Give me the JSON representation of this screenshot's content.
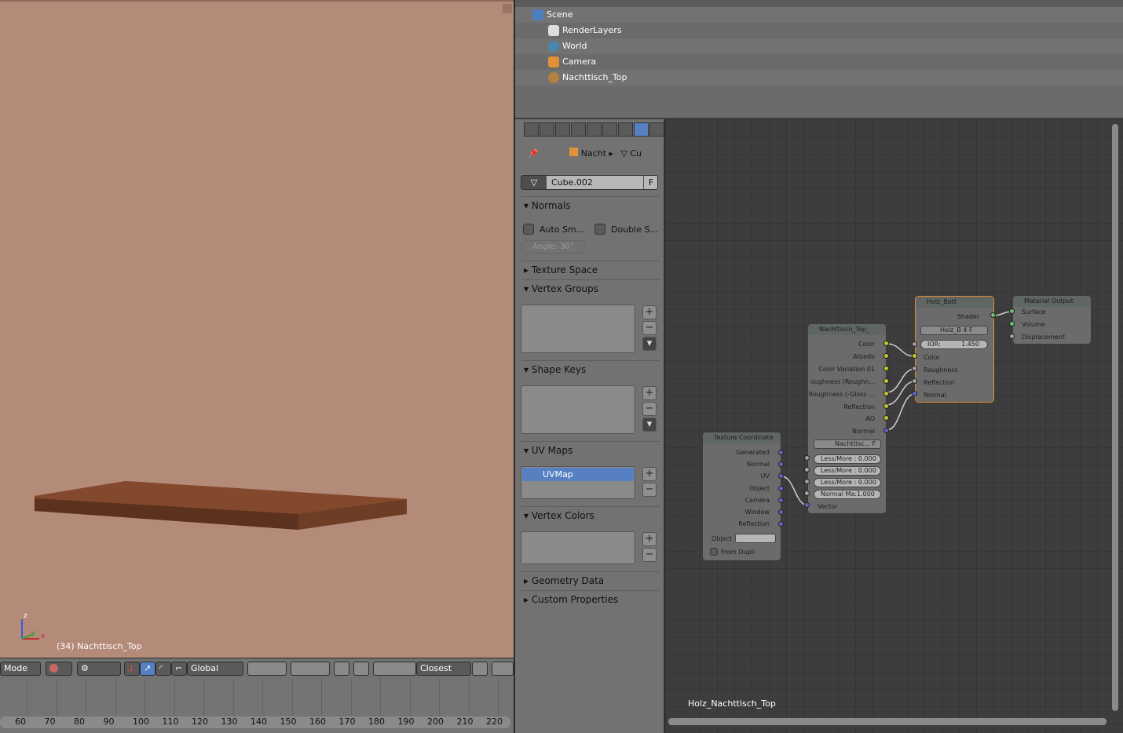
{
  "viewport": {
    "label": "(34) Nachttisch_Top",
    "bg": "#b48a79",
    "axes": {
      "z": "z",
      "y": "y",
      "x": "x"
    }
  },
  "view_header": {
    "mode": "Mode",
    "orientation": "Global",
    "snap": "Closest"
  },
  "timeline": {
    "ticks": [
      "60",
      "70",
      "80",
      "90",
      "100",
      "110",
      "120",
      "130",
      "140",
      "150",
      "160",
      "170",
      "180",
      "190",
      "200",
      "210",
      "220"
    ]
  },
  "outliner": {
    "items": [
      {
        "label": "Scene",
        "icon": "scene-icon"
      },
      {
        "label": "RenderLayers",
        "icon": "render-layers-icon"
      },
      {
        "label": "World",
        "icon": "world-icon"
      },
      {
        "label": "Camera",
        "icon": "camera-icon"
      },
      {
        "label": "Nachttisch_Top",
        "icon": "mesh-icon"
      }
    ]
  },
  "properties": {
    "breadcrumb": {
      "object": "Nacht",
      "data": "Cu"
    },
    "mesh_name": "Cube.002",
    "fake_user": "F",
    "panels": {
      "normals": "Normals",
      "auto_smooth": "Auto Sm...",
      "double_sided": "Double S...",
      "angle": "Angle: 30°",
      "texture_space": "Texture Space",
      "vertex_groups": "Vertex Groups",
      "shape_keys": "Shape Keys",
      "uv_maps": "UV Maps",
      "uv_map_item": "UVMap",
      "vertex_colors": "Vertex Colors",
      "geometry_data": "Geometry Data",
      "custom_properties": "Custom Properties"
    }
  },
  "node_editor": {
    "tree_name": "Holz_Nachttisch_Top",
    "tex_coord": {
      "title": "Texture Coordinate",
      "outputs": [
        "Generated",
        "Normal",
        "UV",
        "Object",
        "Camera",
        "Window",
        "Reflection"
      ],
      "object_label": "Object",
      "from_dupli": "From Dupli"
    },
    "group": {
      "title": "Nachttisch_Top_",
      "outputs": [
        "Color",
        "Albedo",
        "Color Variation 01",
        "oughness (Roughn...",
        "Roughness (-Gloss ...",
        "Reflection",
        "AO",
        "Normal"
      ],
      "datablock": "Nachttisc...",
      "fake": "F",
      "inputs": [
        "Less/More : 0.000",
        "Less/More : 0.000",
        "Less/More : 0.000",
        "Normal Ma:1.000"
      ],
      "vector": "Vector"
    },
    "shader": {
      "title": "Holz_Bett",
      "output": "Shader",
      "datablock": "Holz_B",
      "users": "4",
      "fake": "F",
      "ior_label": "IOR:",
      "ior": "1.450",
      "inputs": [
        "Color",
        "Roughness",
        "Reflection",
        "Normal"
      ]
    },
    "output": {
      "title": "Material Output",
      "inputs": [
        "Surface",
        "Volume",
        "Displacement"
      ]
    }
  },
  "colors": {
    "selected_node_border": "#e38c2c",
    "active_tab": "#5680c2"
  }
}
